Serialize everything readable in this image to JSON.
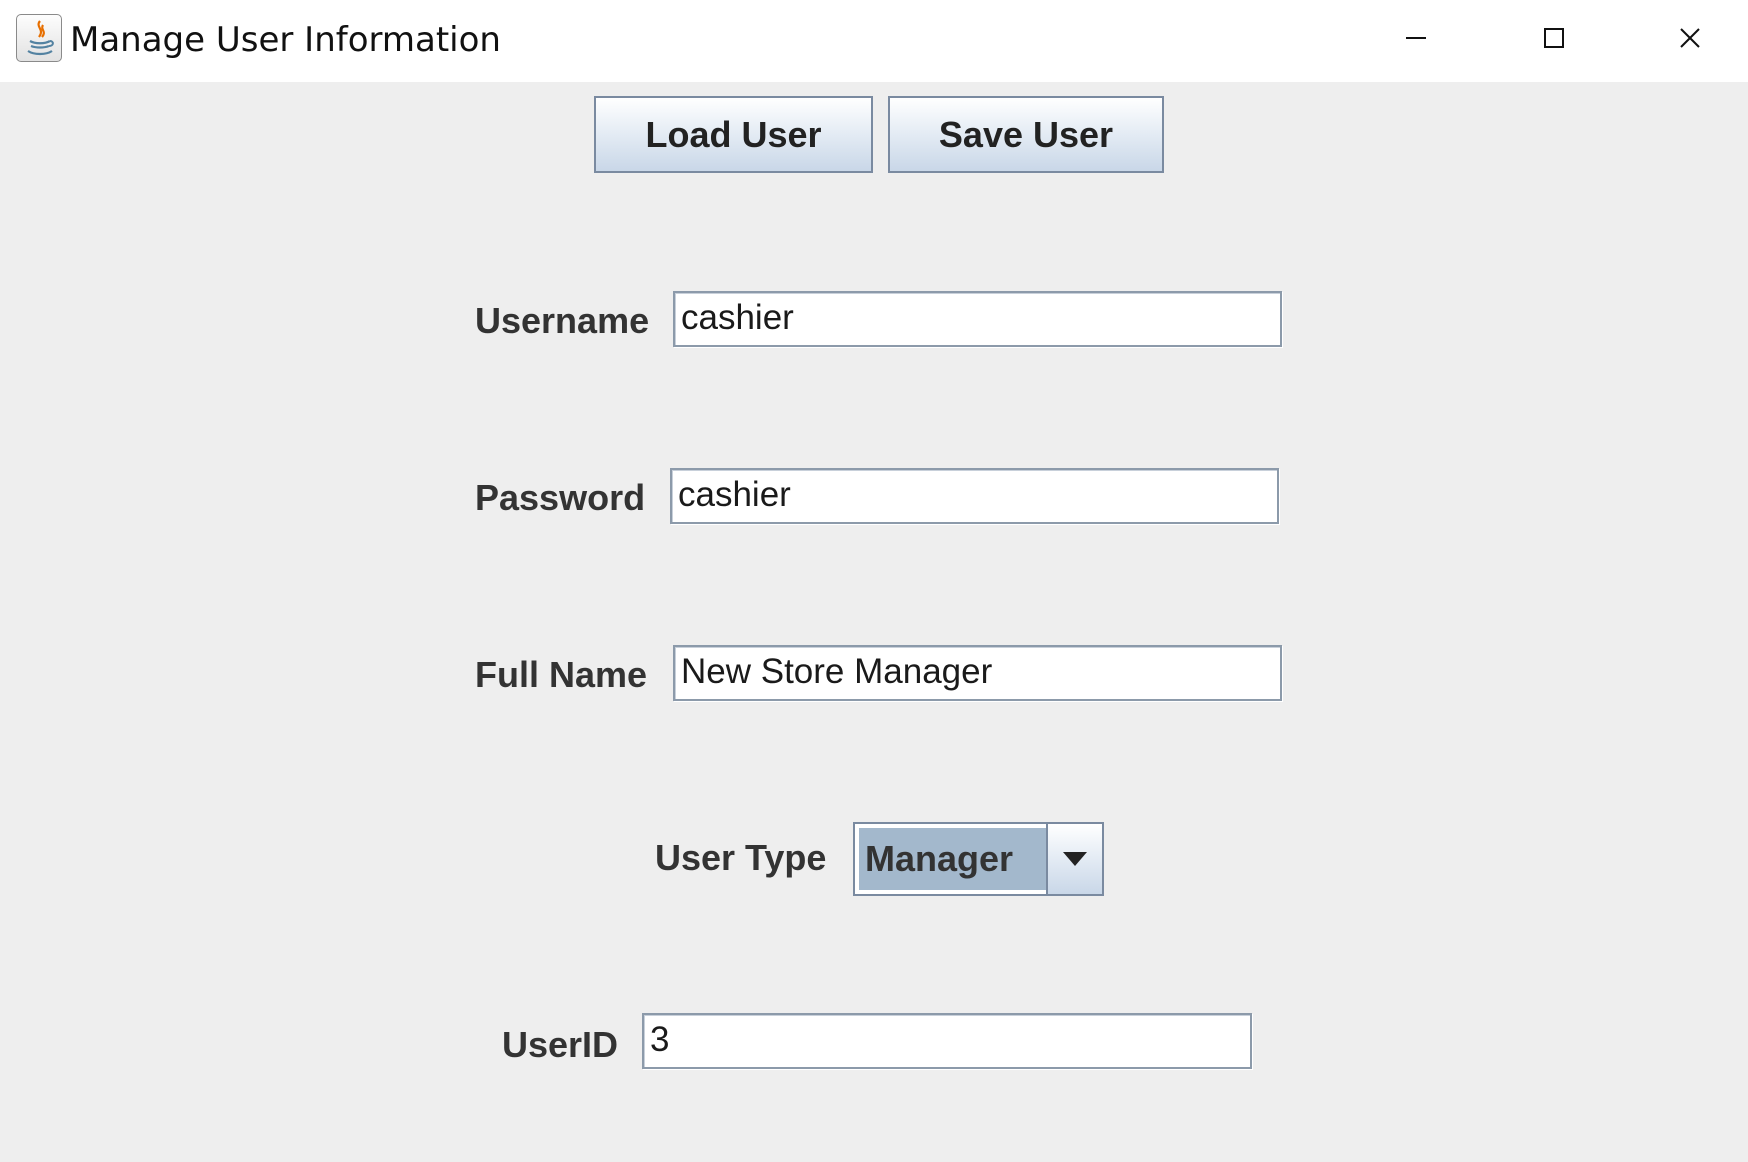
{
  "window": {
    "title": "Manage User Information",
    "controls": {
      "minimize_icon": "minimize-icon",
      "maximize_icon": "maximize-icon",
      "close_icon": "close-icon"
    },
    "app_icon": "java-icon"
  },
  "toolbar": {
    "load_label": "Load User",
    "save_label": "Save User"
  },
  "form": {
    "username": {
      "label": "Username",
      "value": "cashier"
    },
    "password": {
      "label": "Password",
      "value": "cashier"
    },
    "full_name": {
      "label": "Full Name",
      "value": "New Store Manager"
    },
    "user_type": {
      "label": "User Type",
      "selected": "Manager",
      "dropdown_icon": "chevron-down-icon"
    },
    "user_id": {
      "label": "UserID",
      "value": "3"
    }
  },
  "colors": {
    "background": "#eeeeee",
    "titlebar": "#ffffff",
    "button_border": "#7a8aa0",
    "combo_selected": "#a3b8cc",
    "text": "#333333"
  }
}
